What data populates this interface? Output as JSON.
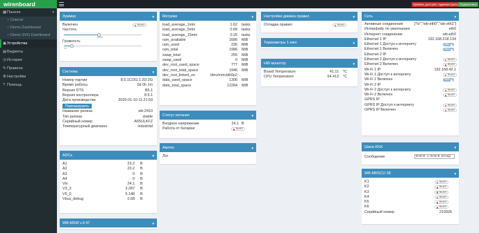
{
  "app": {
    "logo": "wirenboard",
    "access_badge": "Уровень доступа: Администратор",
    "conn_badge": "Подключено"
  },
  "sidebar": {
    "items": [
      {
        "label": "Панели",
        "icon": "dashboard-icon",
        "active": false
      },
      {
        "label": "Список",
        "sub": true
      },
      {
        "label": "Demo Dashboard",
        "sub": true
      },
      {
        "label": "Demo SVG Dashboard",
        "sub": true
      },
      {
        "label": "Устройства",
        "icon": "devices-icon",
        "active": true
      },
      {
        "label": "Виджеты",
        "icon": "widgets-icon"
      },
      {
        "label": "История",
        "icon": "history-icon"
      },
      {
        "label": "Правила",
        "icon": "rules-icon"
      },
      {
        "label": "Настройки",
        "icon": "settings-icon"
      },
      {
        "label": "Помощь",
        "icon": "help-icon"
      }
    ]
  },
  "buzzer": {
    "title": "Зуммер",
    "enabled_label": "Включен",
    "enabled_switch": "ВЫКЛ",
    "freq_label": "Частота",
    "freq_tick": "3000",
    "freq_fraction": 0.45,
    "vol_label": "Громкость",
    "vol_tick": "10",
    "vol_fraction": 0.1
  },
  "system": {
    "title": "Система",
    "rows": [
      {
        "k": "Номер партии",
        "v": "8.5.1C/2G.1.2D.2G"
      },
      {
        "k": "Время работы",
        "v": "0d 0h 1m"
      },
      {
        "k": "Версия DTS",
        "v": "B5.1"
      },
      {
        "k": "Версия контроллера",
        "v": "8.5.1"
      },
      {
        "k": "Дата производства",
        "v": "2025-01-10 11:21:59"
      }
    ],
    "reboot": "Перезагрузить",
    "rows2": [
      {
        "k": "Название релиза",
        "v": "wb-2410"
      },
      {
        "k": "Тип релиза",
        "v": "stable"
      },
      {
        "k": "Серийный номер",
        "v": "A55ULKFZ"
      },
      {
        "k": "Температурный диапазон",
        "v": "industrial"
      }
    ]
  },
  "adcs": {
    "title": "ADCs",
    "rows": [
      {
        "k": "A1",
        "v": "23.2",
        "u": "B"
      },
      {
        "k": "A2",
        "v": "23.2",
        "u": "B"
      },
      {
        "k": "A3",
        "v": "0",
        "u": "B"
      },
      {
        "k": "A4",
        "v": "0",
        "u": "B"
      },
      {
        "k": "Vin",
        "v": "24.1",
        "u": "B"
      },
      {
        "k": "V3_3",
        "v": "3.287",
        "u": "B"
      },
      {
        "k": "V5_0",
        "v": "5.148",
        "u": "B"
      },
      {
        "k": "Vbus_debug",
        "v": "0.68",
        "u": "B"
      }
    ]
  },
  "wbmsw": {
    "title": "WB-MSW v.4 47"
  },
  "metrics": {
    "title": "Метрики",
    "rows": [
      {
        "k": "load_average_1min",
        "v": "1.62",
        "u": "tasks"
      },
      {
        "k": "load_average_5min",
        "v": "0.68",
        "u": "tasks"
      },
      {
        "k": "load_average_15min",
        "v": "0.25",
        "u": "tasks"
      },
      {
        "k": "ram_available",
        "v": "1686",
        "u": "MiB"
      },
      {
        "k": "ram_used",
        "v": "236",
        "u": "MiB"
      },
      {
        "k": "ram_total",
        "v": "1986",
        "u": "MiB"
      },
      {
        "k": "swap_total",
        "v": "255",
        "u": "MiB"
      },
      {
        "k": "swap_used",
        "v": "0",
        "u": "MiB"
      },
      {
        "k": "dev_root_used_space",
        "v": "777",
        "u": "MiB"
      },
      {
        "k": "dev_root_total_space",
        "v": "1946",
        "u": "MiB"
      },
      {
        "k": "dev_root_linked_on",
        "v": "/dev/mmcblk0p2",
        "u": ""
      },
      {
        "k": "data_used_space",
        "v": "1306",
        "u": "MiB"
      },
      {
        "k": "data_total_space",
        "v": "12284",
        "u": "MiB"
      }
    ]
  },
  "power": {
    "title": "Статус питания",
    "vin_label": "Входное напряжение",
    "vin_value": "24.1",
    "vin_unit": "B",
    "battery_label": "Работа от батареи",
    "battery_switch": "ВЫКЛ"
  },
  "alarms": {
    "title": "Alarms",
    "log_label": "Лог"
  },
  "rules_settings": {
    "title": "Настройки движка правил",
    "debug_label": "Отладка правил",
    "debug_switch": "ВЫКЛ"
  },
  "onewire": {
    "title": "Термометры 1-wire"
  },
  "hw_monitor": {
    "title": "HW монитор",
    "rows": [
      {
        "k": "Board Temperature",
        "v": "41.11",
        "u": "°C"
      },
      {
        "k": "CPU Temperature",
        "v": "54.413",
        "u": "°C"
      }
    ]
  },
  "network": {
    "title": "Сеть",
    "rows": [
      {
        "k": "Активные соединения",
        "v": "[\"lo\",\"wb-eth0\",\"wb-eth1\"]"
      },
      {
        "k": "Интерфейс по умолчанию",
        "v": "eth0"
      },
      {
        "k": "Интернет соединение",
        "v": "wb-eth0"
      },
      {
        "k": "Ethernet 1 IP",
        "v": "192.168.218.134"
      },
      {
        "k": "Ethernet 1 Доступ к интернету",
        "sw": "ВКЛ"
      },
      {
        "k": "Ethernet 1 Включен",
        "sw": "ВКЛ"
      },
      {
        "k": "Ethernet 2 IP",
        "v": ""
      },
      {
        "k": "Ethernet 2 Доступ к интернету",
        "sw": "ВЫКЛ"
      },
      {
        "k": "Ethernet 2 Включен",
        "sw": "ВЫКЛ"
      },
      {
        "k": "Wi-Fi 1 IP",
        "v": "192.168.42.1"
      },
      {
        "k": "Wi-Fi 1 Доступ к интернету",
        "sw": "ВЫКЛ"
      },
      {
        "k": "Wi-Fi 1 Включен",
        "sw": "ВКЛ"
      },
      {
        "k": "Wi-Fi 2 IP",
        "v": ""
      },
      {
        "k": "Wi-Fi 2 Доступ к интернету",
        "sw": "ВЫКЛ"
      },
      {
        "k": "Wi-Fi 2 Включен",
        "sw": "ВЫКЛ"
      },
      {
        "k": "GPRS IP",
        "v": ""
      },
      {
        "k": "GPRS IP Доступ к интернету",
        "sw": "ВЫКЛ"
      },
      {
        "k": "GPRS IP Включен",
        "sw": "ВЫКЛ"
      }
    ]
  },
  "knx": {
    "title": "Шина KNX",
    "msg_label": "Сообщение",
    "msg_value": "0/0/0 i:0/0/0 Group"
  },
  "mrcu": {
    "title": "WB-MRSCU 38",
    "rows": [
      {
        "k": "K1",
        "sw": "ВЫКЛ"
      },
      {
        "k": "K2",
        "sw": "ВЫКЛ"
      },
      {
        "k": "K3",
        "sw": "ВЫКЛ"
      },
      {
        "k": "K4",
        "sw": "ВЫКЛ"
      },
      {
        "k": "K5",
        "sw": "ВЫКЛ"
      },
      {
        "k": "K6",
        "sw": "ВЫКЛ"
      }
    ],
    "serial_label": "Серийный номер",
    "serial_value": "210926"
  }
}
